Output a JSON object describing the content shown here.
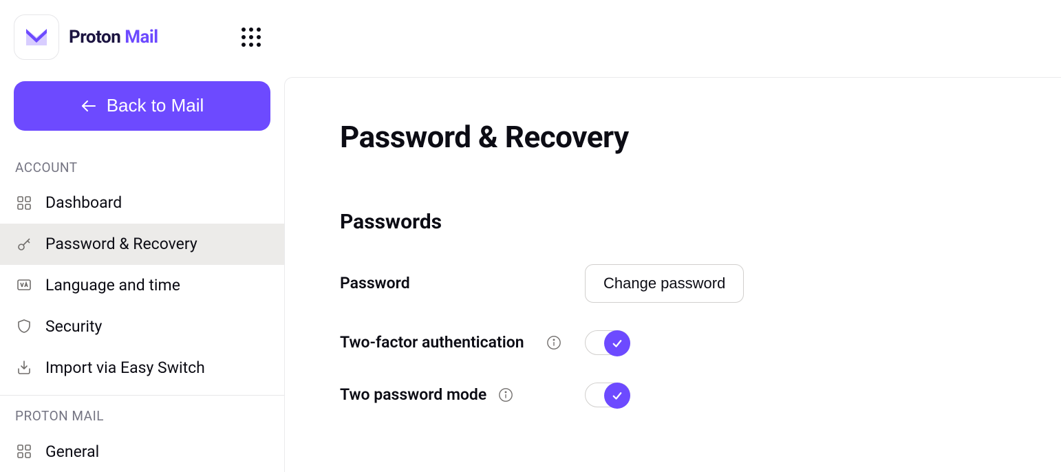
{
  "brand": {
    "primary": "Proton",
    "secondary": "Mail"
  },
  "back_button": "Back to Mail",
  "sidebar": {
    "sections": [
      {
        "label": "Account",
        "items": [
          {
            "label": "Dashboard"
          },
          {
            "label": "Password & Recovery"
          },
          {
            "label": "Language and time"
          },
          {
            "label": "Security"
          },
          {
            "label": "Import via Easy Switch"
          }
        ]
      },
      {
        "label": "Proton Mail",
        "items": [
          {
            "label": "General"
          }
        ]
      }
    ]
  },
  "main": {
    "title": "Password & Recovery",
    "section_title": "Passwords",
    "password_label": "Password",
    "change_password": "Change password",
    "twofa_label": "Two-factor authentication",
    "two_password_label": "Two password mode"
  }
}
